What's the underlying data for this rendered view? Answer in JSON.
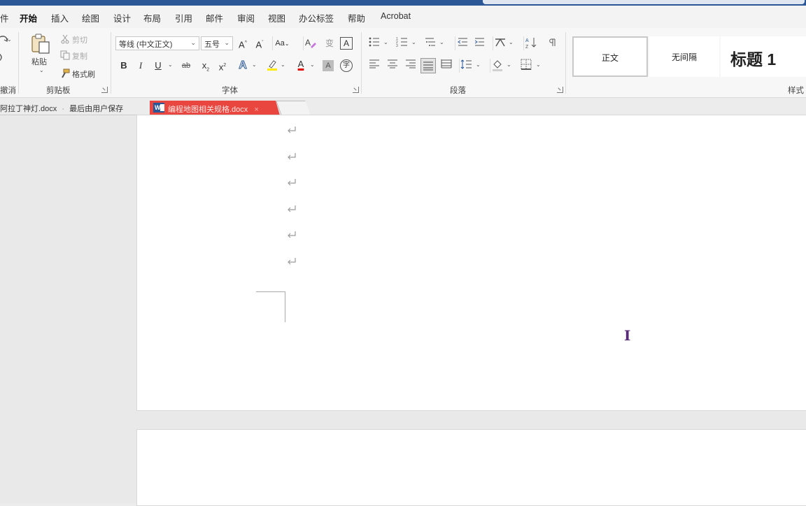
{
  "menu": {
    "file_fragment": "件",
    "tabs": [
      {
        "label": "开始",
        "active": true
      },
      {
        "label": "插入"
      },
      {
        "label": "绘图"
      },
      {
        "label": "设计"
      },
      {
        "label": "布局"
      },
      {
        "label": "引用"
      },
      {
        "label": "邮件"
      },
      {
        "label": "审阅"
      },
      {
        "label": "视图"
      },
      {
        "label": "办公标签"
      },
      {
        "label": "帮助"
      },
      {
        "label": "Acrobat"
      }
    ]
  },
  "ribbon": {
    "undo": {
      "label_fragment": "撤消"
    },
    "clipboard": {
      "paste_label": "粘贴",
      "cut_label": "剪切",
      "copy_label": "复制",
      "format_painter_label": "格式刷",
      "group_label": "剪贴板"
    },
    "font": {
      "font_name": "等线 (中文正文)",
      "font_size": "五号",
      "grow_font": "A",
      "shrink_font": "A",
      "change_case": "Aa",
      "phonetic_guide": "变",
      "char_border": "A",
      "bold": "B",
      "italic": "I",
      "underline": "U",
      "strikethrough": "ab",
      "subscript": "x",
      "superscript": "x",
      "text_effects": "A",
      "font_color": "A",
      "char_shading": "A",
      "enclose_char": "字",
      "group_label": "字体"
    },
    "paragraph": {
      "sort_label": "A Z",
      "group_label": "段落"
    },
    "styles": {
      "items": [
        {
          "label": "正文",
          "selected": true
        },
        {
          "label": "无间隔"
        },
        {
          "label": "标题 1"
        }
      ],
      "group_label": "样式"
    }
  },
  "doc_tabs": [
    {
      "label": "阿拉丁神灯.docx",
      "suffix": "最后由用户保存",
      "active": false
    },
    {
      "label": "编程地图相关规格.docx",
      "active": true
    }
  ],
  "colors": {
    "accent": "#2b5797",
    "active_tab": "#e8463f",
    "cursor": "#5a2a7a"
  },
  "document": {
    "paragraph_mark_count": 6
  }
}
